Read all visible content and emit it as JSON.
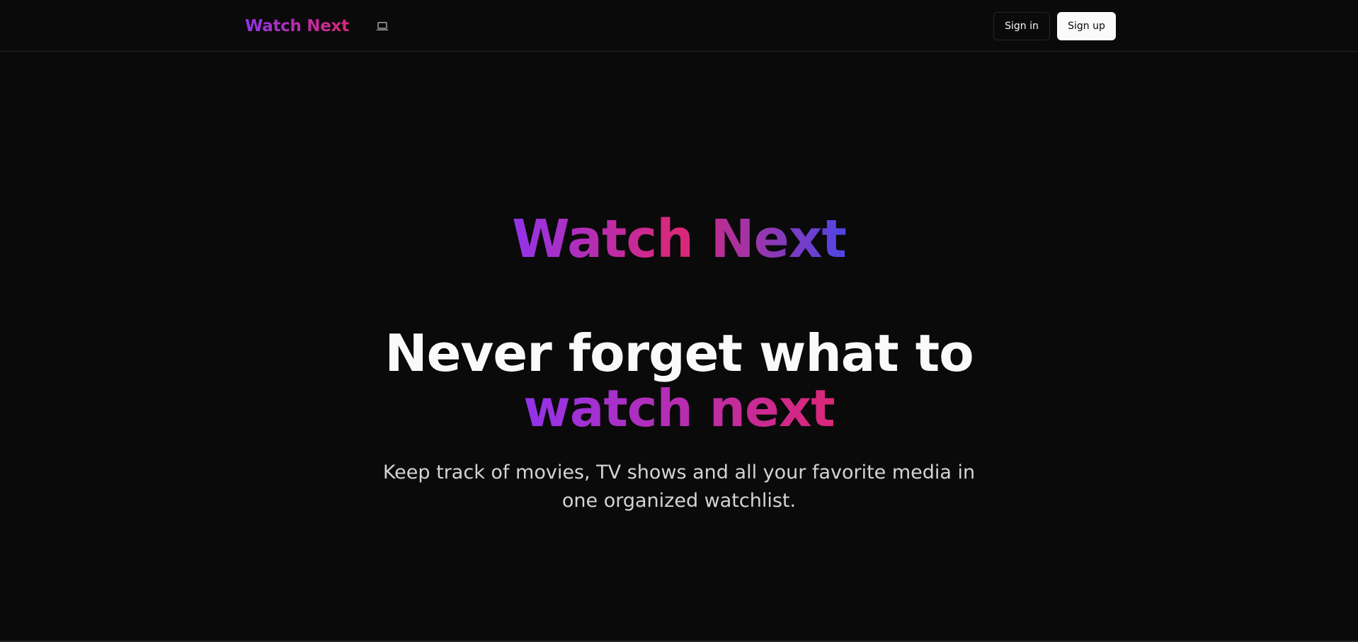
{
  "header": {
    "brand": "Watch Next",
    "theme_toggle_icon": "laptop-icon",
    "signin_label": "Sign in",
    "signup_label": "Sign up"
  },
  "hero": {
    "title": "Watch Next",
    "heading_part1": "Never forget what to",
    "heading_accent": "watch next",
    "subtitle": "Keep track of movies, TV shows and all your favorite media in one organized watchlist."
  },
  "colors": {
    "background": "#0a0a0a",
    "gradient_start": "#9333ea",
    "gradient_mid": "#db2777",
    "gradient_end": "#4f46e5",
    "text_primary": "#fafafa",
    "text_muted": "#d4d4d8"
  }
}
